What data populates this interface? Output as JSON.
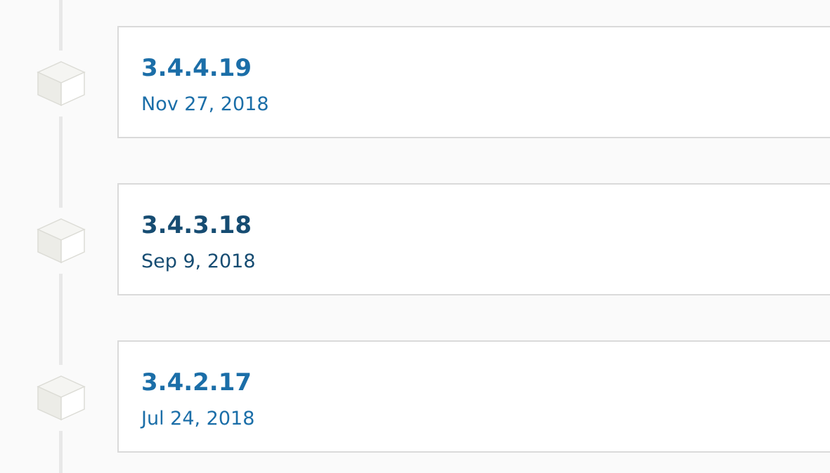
{
  "releases": [
    {
      "version": "3.4.4.19",
      "date": "Nov 27, 2018"
    },
    {
      "version": "3.4.3.18",
      "date": "Sep 9, 2018"
    },
    {
      "version": "3.4.2.17",
      "date": "Jul 24, 2018"
    }
  ],
  "colors": {
    "link": "#1b6ea8",
    "link_visited": "#164c72",
    "card_border": "#dadada",
    "background": "#fafafa",
    "timeline_line": "#e8e8e8",
    "cube_face": "#efefeb"
  }
}
